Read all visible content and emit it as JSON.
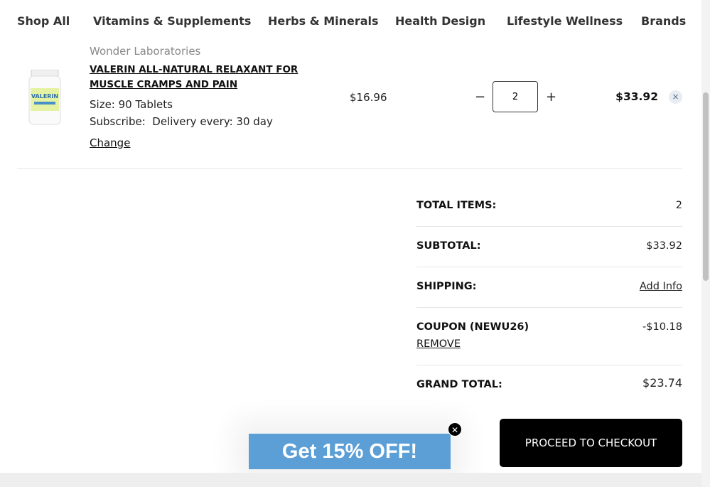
{
  "nav": {
    "items": [
      "Shop All",
      "Vitamins & Supplements",
      "Herbs & Minerals",
      "Health Design",
      "Lifestyle Wellness",
      "Brands"
    ]
  },
  "cart_item": {
    "brand": "Wonder Laboratories",
    "name": "VALERIN ALL-NATURAL RELAXANT FOR MUSCLE CRAMPS AND PAIN",
    "size": "Size: 90 Tablets",
    "subscribe": "Subscribe:  Delivery every: 30 day",
    "change_label": "Change",
    "unit_price": "$16.96",
    "quantity": "2",
    "decrement": "−",
    "increment": "+",
    "line_total": "$33.92",
    "remove_icon": "×",
    "thumbnail_label": "VALERIN"
  },
  "summary": {
    "total_items_label": "TOTAL ITEMS:",
    "total_items": "2",
    "subtotal_label": "SUBTOTAL:",
    "subtotal": "$33.92",
    "shipping_label": "SHIPPING:",
    "shipping_link": "Add Info",
    "coupon_label": "COUPON (NEWU26)",
    "coupon_value": "-$10.18",
    "coupon_remove": "REMOVE",
    "grand_total_label": "GRAND TOTAL:",
    "grand_total": "$23.74"
  },
  "checkout_label": "PROCEED TO CHECKOUT",
  "promo": {
    "label": "Get 15% OFF!",
    "close_icon": "✕",
    "color": "#5b9fd6"
  }
}
